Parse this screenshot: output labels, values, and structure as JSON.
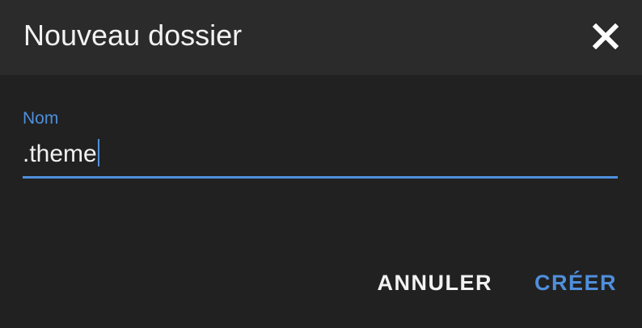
{
  "dialog": {
    "title": "Nouveau dossier",
    "close_icon": "close-icon"
  },
  "field": {
    "label": "Nom",
    "value": ".theme"
  },
  "actions": {
    "cancel_label": "ANNULER",
    "create_label": "CRÉER"
  },
  "colors": {
    "accent": "#4f8fdc",
    "background": "#212121",
    "header": "#2b2b2b",
    "text": "#f2f2f2"
  }
}
